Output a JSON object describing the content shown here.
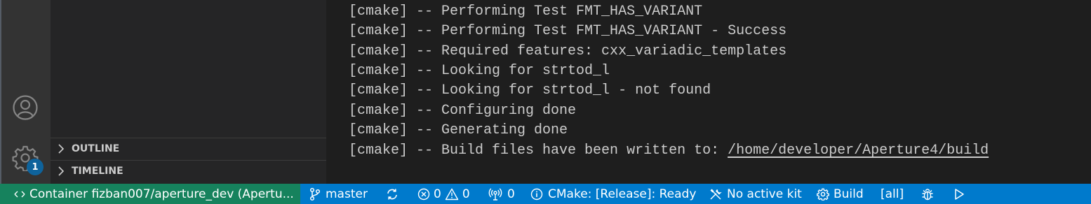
{
  "sidebar": {
    "sections": [
      {
        "label": "OUTLINE"
      },
      {
        "label": "TIMELINE"
      }
    ]
  },
  "activity_bar": {
    "icons": [
      "account-icon",
      "gear-icon"
    ],
    "settings_badge": "1"
  },
  "terminal": {
    "lines": [
      "[cmake] -- Performing Test FMT_HAS_VARIANT",
      "[cmake] -- Performing Test FMT_HAS_VARIANT - Success",
      "[cmake] -- Required features: cxx_variadic_templates",
      "[cmake] -- Looking for strtod_l",
      "[cmake] -- Looking for strtod_l - not found",
      "[cmake] -- Configuring done",
      "[cmake] -- Generating done",
      "[cmake] -- Build files have been written to: "
    ],
    "link_path": "/home/developer/Aperture4/build"
  },
  "status_bar": {
    "remote": "Container fizban007/aperture_dev (Apertu...",
    "branch": "master",
    "errors": "0",
    "warnings": "0",
    "ports": "0",
    "cmake_status": "CMake: [Release]: Ready",
    "kit": "No active kit",
    "build": "Build",
    "target": "[all]",
    "colors": {
      "background": "#007acc",
      "remote_background": "#16825d"
    }
  }
}
